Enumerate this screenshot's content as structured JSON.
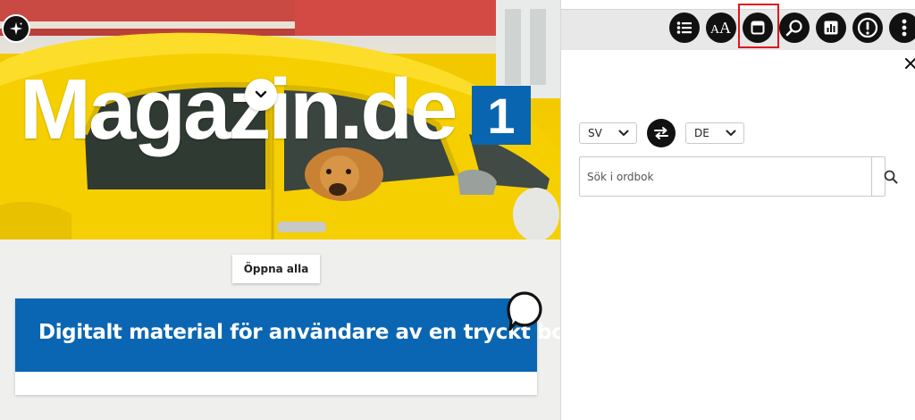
{
  "magazine": {
    "masthead": "Magazin.de",
    "issue": "1"
  },
  "content": {
    "open_all_label": "Öppna alla",
    "card_title": "Digitalt material för användare av en tryckt bok"
  },
  "toolbar": {
    "items": [
      {
        "icon": "list-icon"
      },
      {
        "icon": "font-size-icon",
        "glyph": "AA"
      },
      {
        "icon": "window-icon",
        "highlighted": true
      },
      {
        "icon": "search-icon"
      },
      {
        "icon": "bar-chart-icon"
      },
      {
        "icon": "alert-icon"
      },
      {
        "icon": "more-vertical-icon"
      }
    ],
    "highlight_color": "#e0161b"
  },
  "dictionary": {
    "source_lang": "SV",
    "target_lang": "DE",
    "search_placeholder": "Sök i ordbok"
  },
  "colors": {
    "brand_blue": "#0a66b2",
    "car_yellow": "#f6d000",
    "toolbar_bg": "#e8e8e8"
  }
}
